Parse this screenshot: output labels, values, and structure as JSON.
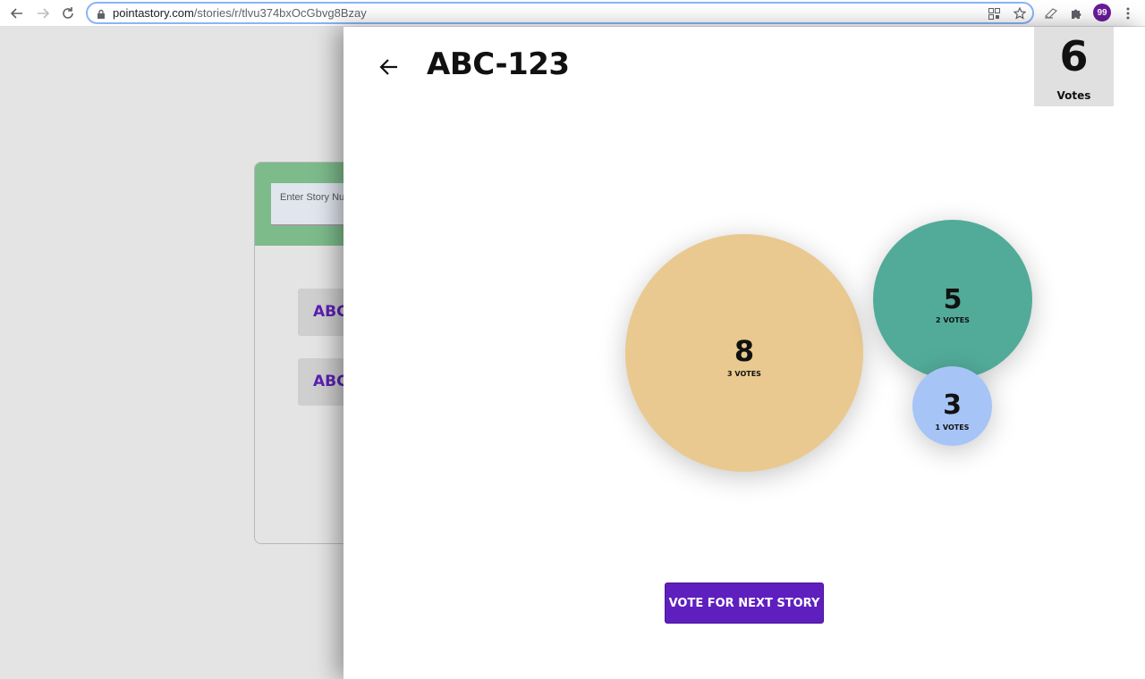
{
  "browser": {
    "url_domain": "pointastory.com",
    "url_path": "/stories/r/tlvu374bxOcGbvg8Bzay",
    "profile_initials": "99"
  },
  "background": {
    "input_placeholder": "Enter Story Number",
    "items": [
      {
        "label": "ABC-"
      },
      {
        "label": "ABC-"
      }
    ]
  },
  "drawer": {
    "story_title": "ABC-123",
    "total_votes": "6",
    "votes_label": "Votes",
    "bubbles": [
      {
        "value": "8",
        "votes": "3 votes",
        "color": "#e9c98f"
      },
      {
        "value": "5",
        "votes": "2 votes",
        "color": "#52ab99"
      },
      {
        "value": "3",
        "votes": "1 votes",
        "color": "#a7c4f7"
      }
    ],
    "next_button_label": "Vote for next story"
  },
  "colors": {
    "accent": "#5f1fbf",
    "header_green": "#7dbb8b"
  },
  "icons": {
    "back": "arrow-left-icon",
    "forward": "arrow-right-icon",
    "reload": "reload-icon",
    "lock": "lock-icon",
    "qr": "qr-code-icon",
    "star": "star-icon",
    "extension": "puzzle-icon",
    "menu": "more-vertical-icon"
  }
}
